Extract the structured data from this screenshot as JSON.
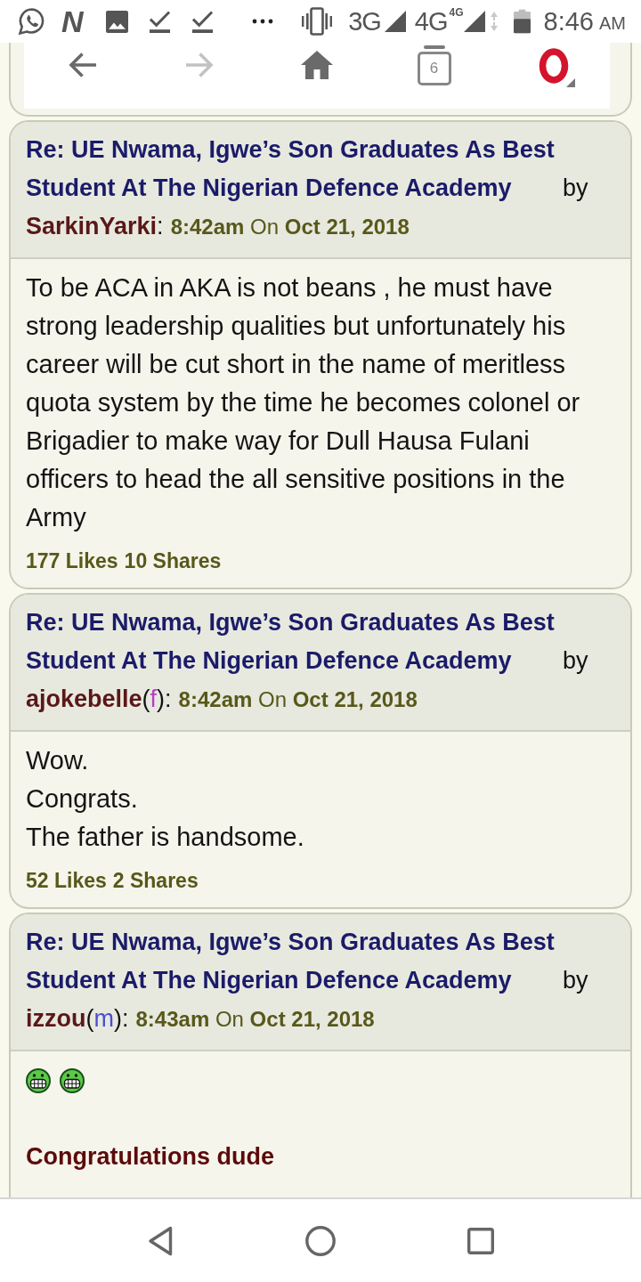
{
  "status_bar": {
    "notification_letter": "N",
    "network_1": "3G",
    "network_2": "4G",
    "network_2_badge": "4G",
    "time": "8:46",
    "period": "AM"
  },
  "previous_post": {
    "toolbar": [
      {
        "kind": "back",
        "disabled": false
      },
      {
        "kind": "forward",
        "disabled": true
      },
      {
        "kind": "home",
        "disabled": false
      },
      {
        "kind": "tabs",
        "disabled": false,
        "count": "6"
      },
      {
        "kind": "logo",
        "disabled": false
      }
    ]
  },
  "posts": [
    {
      "title": "Re: UE Nwama, Igwe’s Son Graduates As Best Student At The Nigerian Defence Academy",
      "by": "by",
      "author": "SarkinYarki",
      "separator": ":",
      "timestamp": "**8:42am** On **Oct 21, 2018**",
      "body": [
        {
          "kind": "text",
          "text": "To be ACA in AKA is not beans , he must have strong leadership qualities but unfortunately his career will be cut short in the name of meritless quota system by the time he becomes colonel or Brigadier to make way for Dull Hausa Fulani officers to head the all sensitive positions in the Army"
        }
      ],
      "likes": "177 Likes",
      "shares": "10 Shares"
    },
    {
      "title": "Re: UE Nwama, Igwe’s Son Graduates As Best Student At The Nigerian Defence Academy",
      "by": "by",
      "author": "ajokebelle",
      "gender": {
        "open": "(",
        "letter": "f",
        "close": ")",
        "color": "#b63ec4"
      },
      "separator": ":",
      "timestamp": "**8:42am** On **Oct 21, 2018**",
      "body": [
        {
          "kind": "text",
          "text": "Wow.\nCongrats.\nThe father is handsome."
        }
      ],
      "likes": "52 Likes",
      "shares": "2 Shares"
    },
    {
      "title": "Re: UE Nwama, Igwe’s Son Graduates As Best Student At The Nigerian Defence Academy",
      "by": "by",
      "author": "izzou",
      "gender": {
        "open": "(",
        "letter": "m",
        "close": ")",
        "color": "#4a4ed0"
      },
      "separator": ":",
      "timestamp": "**8:43am** On **Oct 21, 2018**",
      "body": [
        {
          "kind": "smileys",
          "items": [
            {
              "kind": "grin"
            },
            {
              "kind": "grin"
            }
          ]
        },
        {
          "kind": "emphasis",
          "text": "Congratulations dude"
        }
      ]
    }
  ]
}
